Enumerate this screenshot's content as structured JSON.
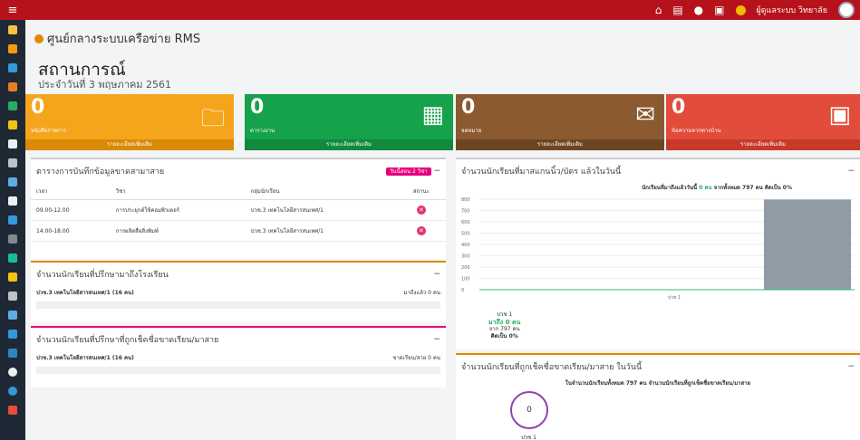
{
  "topbar": {
    "menu_icon": "menu-icon",
    "home_icon": "home-icon",
    "file_icon": "file-icon",
    "info_icon": "info-icon",
    "calendar_icon": "calendar-icon",
    "user_name": "ผู้ดูแลระบบ วิทยาลัย"
  },
  "brand": {
    "title": "ศูนย์กลางระบบเครือข่าย RMS"
  },
  "header": {
    "title": "สถานการณ์",
    "subtitle": "ประจำวันที่ 3 พฤษภาคม 2561"
  },
  "stats": [
    {
      "value": "0",
      "label": "หนังสือราชการ",
      "more": "รายละเอียดเพิ่มเติม",
      "icon": "folder-document-icon",
      "color": "#f5a51c",
      "bar": "#d98a06"
    },
    {
      "value": "0",
      "label": "ตารางงาน",
      "more": "รายละเอียดเพิ่มเติม",
      "icon": "calendar-grid-icon",
      "color": "#16a14b",
      "bar": "#108a3d"
    },
    {
      "value": "0",
      "label": "จดหมาย",
      "more": "รายละเอียดเพิ่มเติม",
      "icon": "envelope-icon",
      "color": "#8b5a30",
      "bar": "#6e4522"
    },
    {
      "value": "0",
      "label": "ข้อความจากทางบ้าน",
      "more": "รายละเอียดเพิ่มเติม",
      "icon": "message-icon",
      "color": "#e14c3b",
      "bar": "#c73a2a"
    }
  ],
  "panel_schedule": {
    "title": "ตารางการบันทึกข้อมูลขาดสามาสาย",
    "badge": "วันนี้สอน 2 วิชา",
    "columns": [
      "เวลา",
      "วิชา",
      "กลุ่มนักเรียน",
      "สถานะ"
    ],
    "rows": [
      {
        "time": "09.00-12.00",
        "subject": "การประยุกต์ใช้คอมพิวเตอร์",
        "group": "ปวช.3 เทคโนโลยีสารสนเทศ/1"
      },
      {
        "time": "14.00-18.00",
        "subject": "การผลิตสื่อสิ่งพิมพ์",
        "group": "ปวช.3 เทคโนโลยีสารสนเทศ/1"
      }
    ]
  },
  "panel_arrived": {
    "title": "จำนวนนักเรียนที่ปรึกษามาถึงโรงเรียน",
    "group": "ปวช.3 เทคโนโลยีสารสนเทศ/1 (16 คน)",
    "value": "มาถึงแล้ว 0 คน"
  },
  "panel_absent": {
    "title": "จำนวนนักเรียนที่ปรึกษาที่ถูกเช็คชื่อขาดเรียน/มาสาย",
    "group": "ปวช.3 เทคโนโลยีสารสนเทศ/1 (16 คน)",
    "value": "ขาดเรียน/สาย 0 คน"
  },
  "panel_scan": {
    "title": "จำนวนนักเรียนที่มาสแกนนิ้ว/บัตร แล้วในวันนี้",
    "summary_pre": "นักเรียนที่มาถึงแล้ววันนี้",
    "summary_count": "0 คน",
    "summary_post": "จากทั้งหมด 797 คน คิดเป็น 0%",
    "note_level": "ปวช 1",
    "note_arrived": "มาถึง 0 คน",
    "note_total": "จาก 797 คน",
    "note_pct": "คิดเป็น 0%"
  },
  "panel_checked": {
    "title": "จำนวนนักเรียนที่ถูกเช็คชื่อขาดเรียน/มาสาย ในวันนี้",
    "summary": "ในจำนวนนักเรียนทั้งหมด 797 คน จำนวนนักเรียนที่ถูกเช็คชื่อขาดเรียน/มาสาย",
    "circle_value": "0",
    "circle_label": "ปวช 1"
  },
  "chart_data": {
    "type": "bar",
    "categories": [
      "ปวช 1"
    ],
    "series": [
      {
        "values": [
          797
        ]
      }
    ],
    "ylim": [
      0,
      800
    ],
    "yticks": [
      "800",
      "700",
      "600",
      "500",
      "400",
      "300",
      "200",
      "100",
      "0"
    ],
    "line_value": 0,
    "colors": {
      "bar": "#919ba6",
      "line": "#2fbf71"
    }
  }
}
